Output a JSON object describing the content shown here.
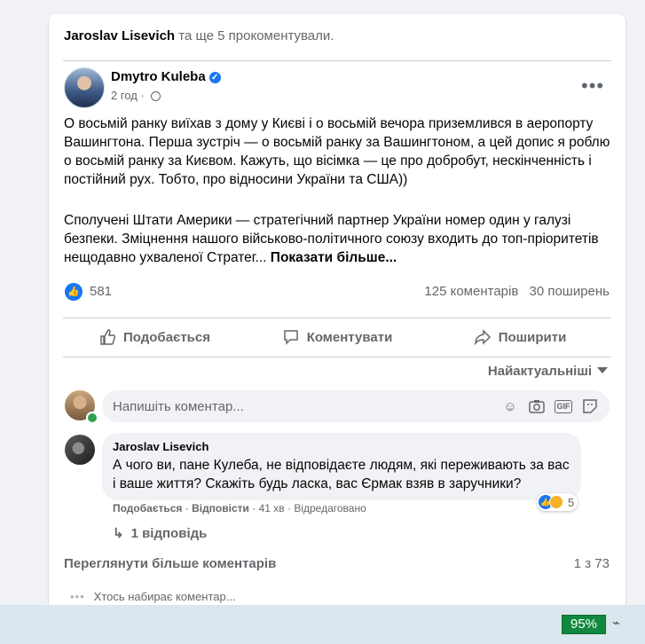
{
  "context": {
    "name": "Jaroslav Lisevich",
    "rest": "та ще 5 прокоментували."
  },
  "post": {
    "author": "Dmytro Kuleba",
    "verified_icon": "check-icon",
    "time": "2 год",
    "paragraph1": "О восьмій ранку виїхав з дому у Києві і о восьмій вечора приземлився в аеропорту Вашингтона. Перша зустріч — о восьмій ранку за Вашингтоном, а цей допис я роблю о восьмій ранку за Києвом. Кажуть, що вісімка — це про добробут, нескінченність і постійний рух. Тобто, про відносини України та США))",
    "paragraph2": "Сполучені Штати Америки — стратегічний партнер України номер один у галузі безпеки. Зміцнення нашого військово-політичного союзу входить до топ-пріоритетів нещодавно ухваленої Стратег...",
    "see_more": "Показати більше..."
  },
  "stats": {
    "likes": "581",
    "comments": "125 коментарів",
    "shares": "30 поширень"
  },
  "actions": {
    "like": "Подобається",
    "comment": "Коментувати",
    "share": "Поширити"
  },
  "sort": {
    "label": "Найактуальніші"
  },
  "composer": {
    "placeholder": "Напишіть коментар..."
  },
  "comment": {
    "author": "Jaroslav Lisevich",
    "text": "А чого ви, пане Кулеба, не відповідаєте людям, які переживають за вас і ваше життя? Скажіть будь ласка, вас Єрмак взяв в заручники?",
    "reactions": "5",
    "like": "Подобається",
    "reply": "Відповісти",
    "time": "41 хв",
    "edited": "Відредаговано",
    "replies": "1 відповідь"
  },
  "footer": {
    "view_more": "Переглянути більше коментарів",
    "pager": "1 з 73",
    "typing": "Хтось набирає коментар..."
  },
  "system": {
    "battery": "95%"
  },
  "colors": {
    "accent": "#1877f2",
    "online": "#31a24c",
    "battery": "#10893e"
  }
}
